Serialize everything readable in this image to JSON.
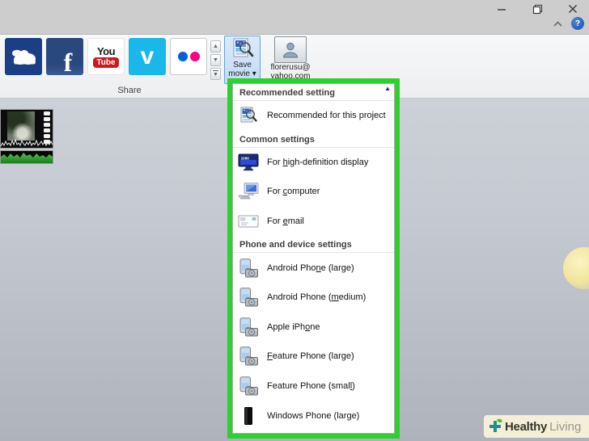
{
  "titlebar": {
    "help_glyph": "?"
  },
  "ribbon": {
    "group_label": "Share",
    "facebook_glyph": "f",
    "youtube_line1": "You",
    "youtube_line2": "Tube",
    "vimeo_glyph": "v",
    "save_movie": {
      "line1": "Save",
      "line2": "movie",
      "arrow": "▾"
    },
    "account": {
      "line1": "florerusu@",
      "line2": "yahoo.com",
      "arrow": "▾"
    }
  },
  "menu": {
    "hd_badge": "1080",
    "scroll_up_glyph": "▲",
    "rows": [
      {
        "type": "header",
        "label": "Recommended setting"
      },
      {
        "type": "item",
        "icon": "movie-project-icon",
        "text": "Recommended for this project",
        "accel": -1
      },
      {
        "type": "header",
        "label": "Common settings"
      },
      {
        "type": "item",
        "icon": "hd-display-icon",
        "text": "For high-definition display",
        "accel": 4
      },
      {
        "type": "item",
        "icon": "computer-icon",
        "text": "For computer",
        "accel": 4
      },
      {
        "type": "item",
        "icon": "email-icon",
        "text": "For email",
        "accel": 4
      },
      {
        "type": "header",
        "label": "Phone and device settings"
      },
      {
        "type": "item",
        "icon": "phone-camera-icon",
        "text": "Android Phone (large)",
        "accel": 11
      },
      {
        "type": "item",
        "icon": "phone-camera-icon",
        "text": "Android Phone (medium)",
        "accel": 15
      },
      {
        "type": "item",
        "icon": "phone-camera-icon",
        "text": "Apple iPhone",
        "accel": 9
      },
      {
        "type": "item",
        "icon": "phone-camera-icon",
        "text": "Feature Phone (large)",
        "accel": 0
      },
      {
        "type": "item",
        "icon": "phone-camera-icon",
        "text": "Feature Phone (small)",
        "accel": 19
      },
      {
        "type": "item",
        "icon": "windows-phone-icon",
        "text": "Windows Phone (large)",
        "accel": 18
      }
    ]
  },
  "watermark": {
    "bold_text": "Healthy",
    "light_text": "Living"
  },
  "colors": {
    "highlight_green": "#2dd12d",
    "flickr_blue": "#0063dc",
    "flickr_pink": "#ff0084",
    "vimeo_teal": "#1ab7ea",
    "youtube_red": "#cc181e",
    "facebook_navy": "#29487d",
    "onedrive_navy": "#1b3f87"
  }
}
